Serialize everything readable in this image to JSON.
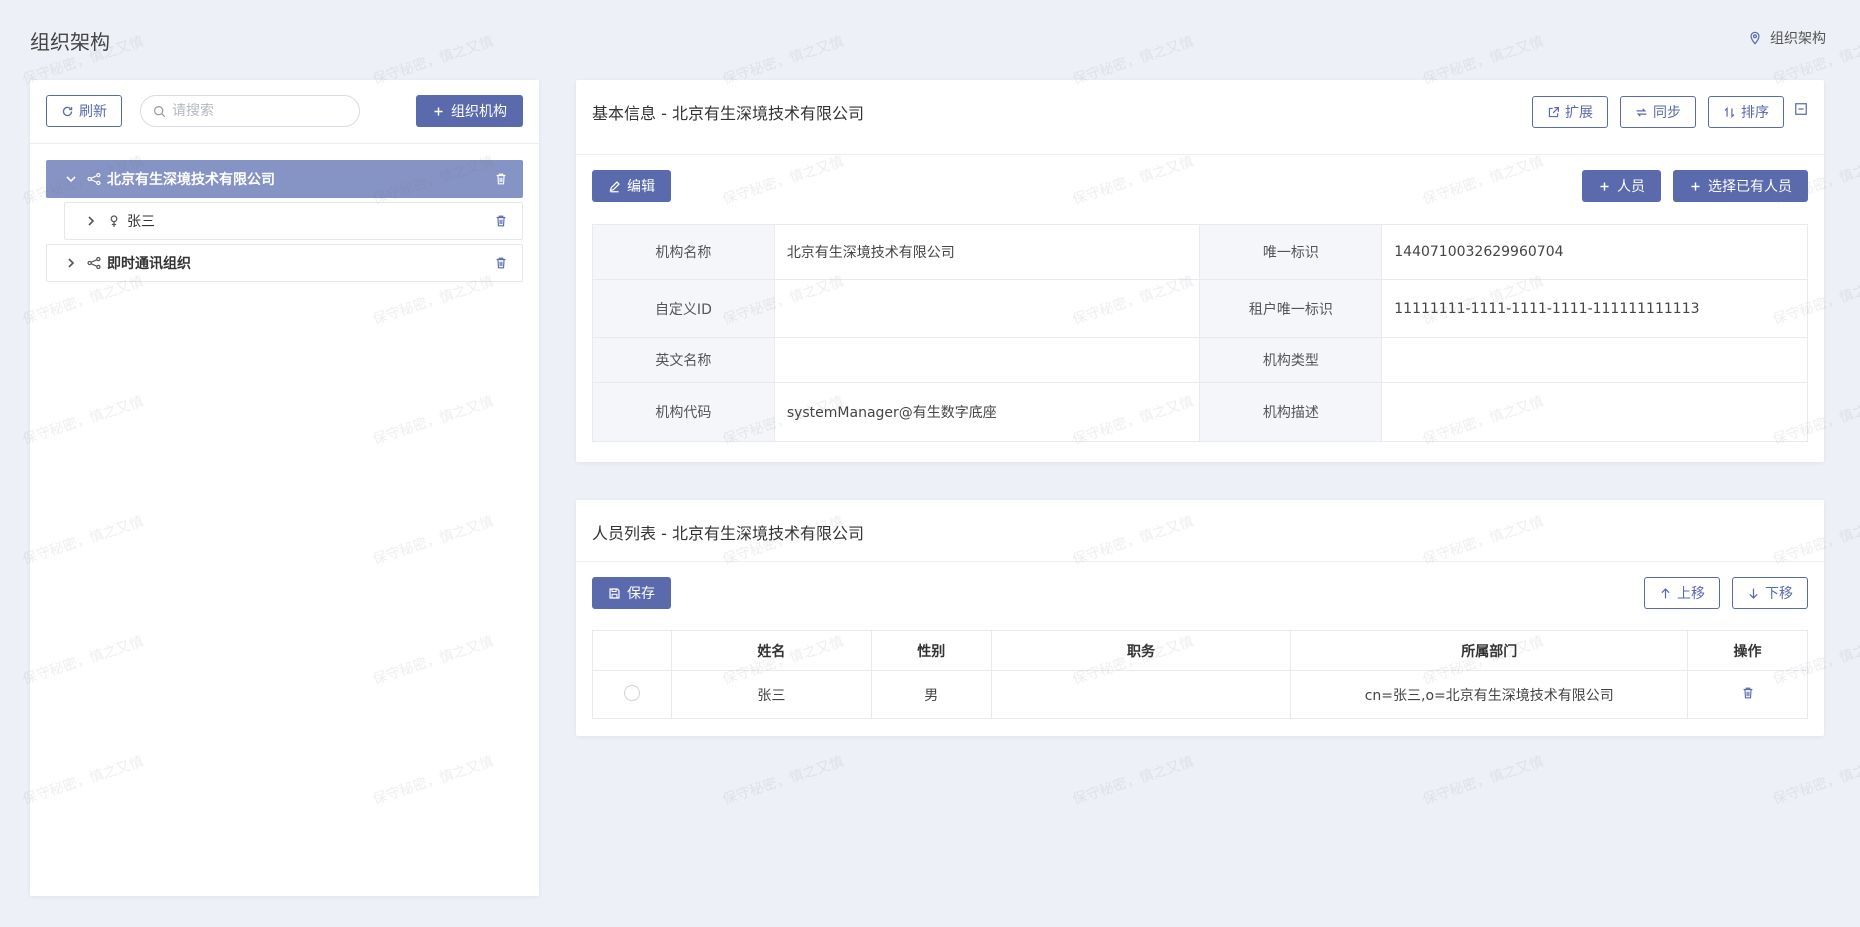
{
  "page": {
    "title": "组织架构",
    "breadcrumb": "组织架构"
  },
  "watermark": "保守秘密，慎之又慎",
  "left": {
    "refresh_label": "刷新",
    "search_placeholder": "请搜索",
    "add_org_label": "组织机构",
    "tree": [
      {
        "label": "北京有生深境技术有限公司",
        "selected": true,
        "expanded": true
      },
      {
        "label": "张三",
        "child": true
      },
      {
        "label": "即时通讯组织"
      }
    ]
  },
  "info": {
    "title": "基本信息 - 北京有生深境技术有限公司",
    "extend_label": "扩展",
    "sync_label": "同步",
    "sort_label": "排序",
    "edit_label": "编辑",
    "add_person_label": "人员",
    "select_person_label": "选择已有人员",
    "fields": {
      "org_name_label": "机构名称",
      "org_name": "北京有生深境技术有限公司",
      "uid_label": "唯一标识",
      "uid": "1440710032629960704",
      "custom_id_label": "自定义ID",
      "custom_id": "",
      "tenant_uid_label": "租户唯一标识",
      "tenant_uid": "11111111-1111-1111-1111-111111111113",
      "en_name_label": "英文名称",
      "en_name": "",
      "org_type_label": "机构类型",
      "org_type": "",
      "org_code_label": "机构代码",
      "org_code": "systemManager@有生数字底座",
      "org_desc_label": "机构描述",
      "org_desc": ""
    }
  },
  "list": {
    "title": "人员列表 - 北京有生深境技术有限公司",
    "save_label": "保存",
    "up_label": "上移",
    "down_label": "下移",
    "columns": [
      "",
      "姓名",
      "性别",
      "职务",
      "所属部门",
      "操作"
    ],
    "rows": [
      {
        "name": "张三",
        "gender": "男",
        "position": "",
        "dept": "cn=张三,o=北京有生深境技术有限公司"
      }
    ]
  },
  "colors": {
    "primary": "#5a6aad",
    "selected_node": "#8593c5",
    "background": "#eef0f7"
  }
}
